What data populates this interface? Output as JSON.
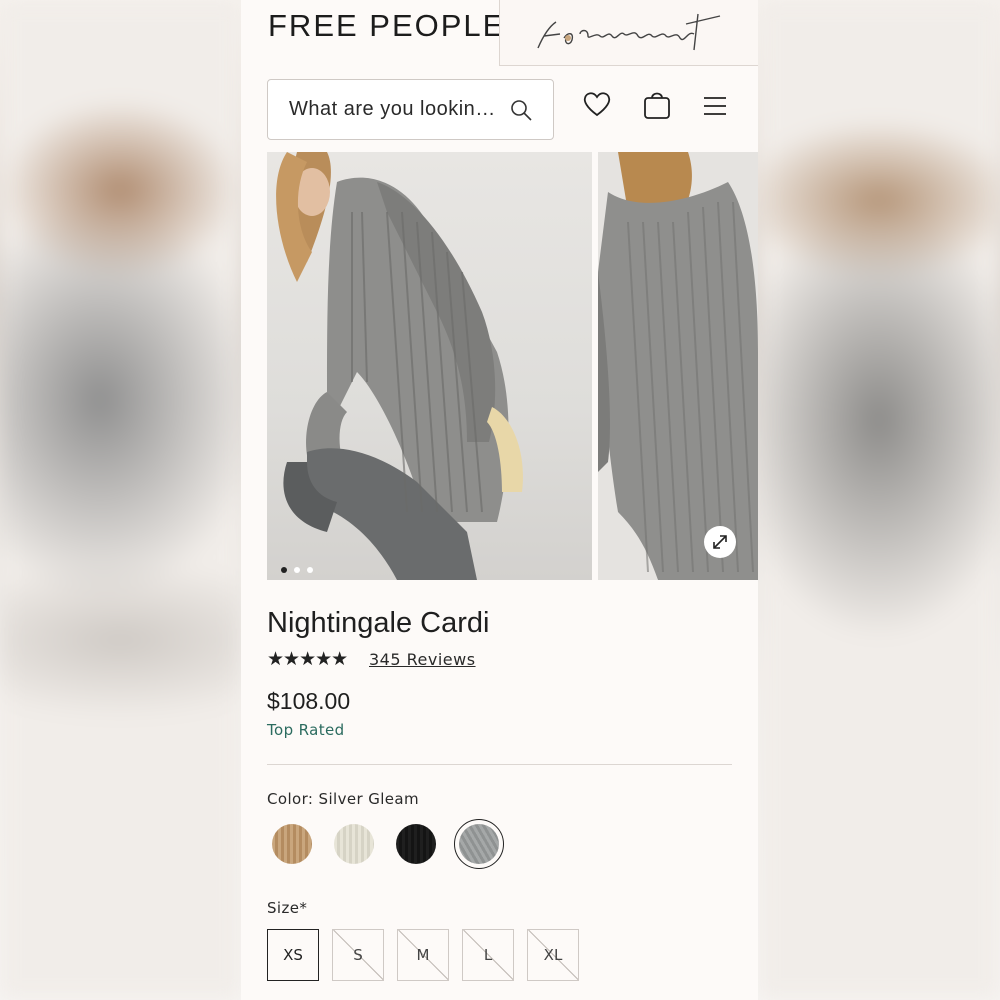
{
  "header": {
    "brand": "FREE PEOPLE",
    "movement_logo": "fp movement",
    "search_placeholder": "What are you looking for?",
    "icons": [
      "heart-icon",
      "bag-icon",
      "menu-icon"
    ]
  },
  "gallery": {
    "dots": 3,
    "active_dot": 1,
    "expand_icon": "expand-icon"
  },
  "product": {
    "title": "Nightingale Cardi",
    "rating": 4.5,
    "stars": "★★★★★",
    "reviews_label": "345 Reviews",
    "price": "$108.00",
    "badge": "Top Rated",
    "badge_color": "#2b6b5f",
    "color_label": "Color: Silver Gleam",
    "swatches": [
      {
        "name": "Tan",
        "color": "#c9a67d"
      },
      {
        "name": "Ivory",
        "color": "#e4e1d3"
      },
      {
        "name": "Black",
        "color": "#1b1b1b"
      },
      {
        "name": "Silver Gleam",
        "color": "#9ea1a1",
        "selected": true
      }
    ],
    "size_label": "Size*",
    "sizes": [
      {
        "label": "XS",
        "available": true,
        "selected": true
      },
      {
        "label": "S",
        "available": false
      },
      {
        "label": "M",
        "available": false
      },
      {
        "label": "L",
        "available": false
      },
      {
        "label": "XL",
        "available": false
      }
    ]
  }
}
